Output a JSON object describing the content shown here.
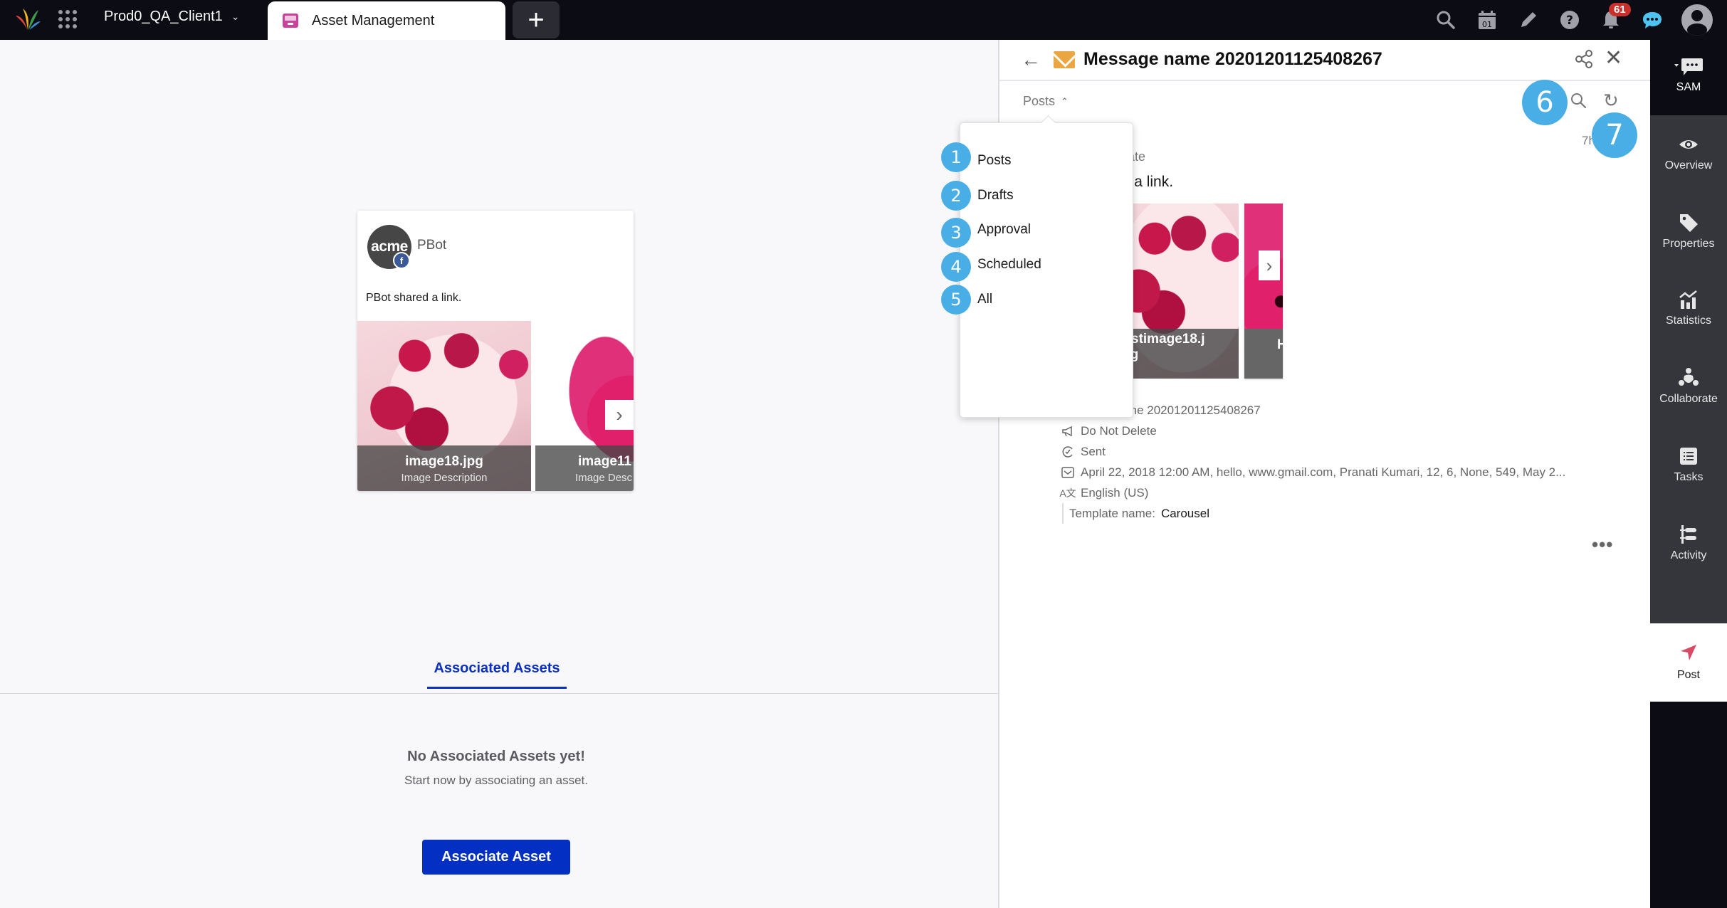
{
  "topbar": {
    "workspace": "Prod0_QA_Client1",
    "active_tab": "Asset Management",
    "notification_count": "61",
    "icons": [
      "search-icon",
      "calendar-icon",
      "pencil-icon",
      "help-icon",
      "bell-icon",
      "chat-icon",
      "user-avatar"
    ]
  },
  "post_card": {
    "avatar_text": "acme",
    "author": "PBot",
    "network_badge": "f",
    "text": "PBot shared a link.",
    "images": [
      {
        "title": "image18.jpg",
        "description": "Image Description"
      },
      {
        "title": "image11",
        "description": "Image Desc"
      }
    ]
  },
  "associated": {
    "tab_label": "Associated Assets",
    "empty_title": "No Associated Assets yet!",
    "empty_subtitle": "Start now by associating an asset.",
    "button_label": "Associate Asset"
  },
  "detail": {
    "title": "Message name 20201201125408267",
    "filter_label": "Posts",
    "time_ago": "7h",
    "post_type_partial": "odate",
    "post_text_partial": "ed a link.",
    "image_caption_line1": "firstimage18.j",
    "image_caption_line2": "pg",
    "image2_caption_partial": "H",
    "meta": {
      "name": "name 20201201125408267",
      "campaign": "Do Not Delete",
      "status": "Sent",
      "custom_fields": "April 22, 2018 12:00 AM, hello, www.gmail.com, Pranati Kumari, 12, 6, None, 549, May 2...",
      "language": "English (US)",
      "template_label": "Template name:",
      "template_value": "Carousel"
    },
    "more_label": "•••"
  },
  "dropdown": {
    "items": [
      "Posts",
      "Drafts",
      "Approval",
      "Scheduled",
      "All"
    ]
  },
  "markers": [
    "1",
    "2",
    "3",
    "4",
    "5",
    "6",
    "7"
  ],
  "sidebar": {
    "sam": "SAM",
    "items": [
      "Overview",
      "Properties",
      "Statistics",
      "Collaborate",
      "Tasks",
      "Activity"
    ],
    "active": "Post"
  },
  "colors": {
    "accent_blue": "#0330c3",
    "marker_blue": "#4aaee6",
    "badge_red": "#c9302c",
    "post_icon": "#d94a64",
    "mail_orange": "#eaa640"
  }
}
